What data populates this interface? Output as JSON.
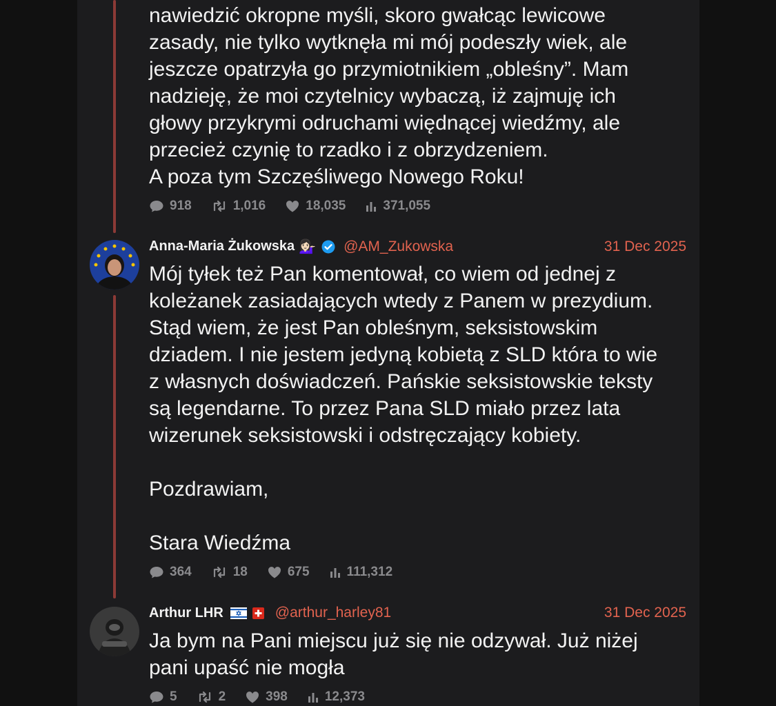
{
  "posts": [
    {
      "text": "nawiedzić okropne myśli, skoro gwałcąc lewicowe\nzasady, nie tylko wytknęła mi mój podeszły wiek, ale\njeszcze opatrzyła go przymiotnikiem „obleśny”. Mam\nnadzieję, że moi czytelnicy wybaczą, iż zajmuję ich\ngłowy przykrymi odruchami więdnącej wiedźmy, ale\nprzecież czynię to rzadko i z obrzydzeniem.\nA poza tym Szczęśliwego Nowego Roku!",
      "stats": {
        "replies": "918",
        "reposts": "1,016",
        "likes": "18,035",
        "views": "371,055"
      }
    },
    {
      "name": "Anna-Maria Żukowska",
      "handle": "@AM_Zukowska",
      "date": "31 Dec 2025",
      "name_emoji": "💁🏻‍♀️",
      "verified_icon": "verified-badge-icon",
      "text": "Mój tyłek też Pan komentował, co wiem od jednej z\nkoleżanek zasiadających wtedy z Panem w prezydium.\nStąd wiem, że jest Pan obleśnym, seksistowskim\ndziadem. I nie jestem jedyną kobietą z SLD która to wie\nz własnych doświadczeń. Pańskie seksistowskie teksty\nsą legendarne. To przez Pana SLD miało przez lata\nwizerunek seksistowski i odstręczający kobiety.\n\nPozdrawiam,\n\nStara Wiedźma",
      "stats": {
        "replies": "364",
        "reposts": "18",
        "likes": "675",
        "views": "111,312"
      }
    },
    {
      "name": "Arthur LHR",
      "handle": "@arthur_harley81",
      "date": "31 Dec 2025",
      "flags": [
        "israel-flag-icon",
        "switzerland-flag-icon"
      ],
      "text": "Ja bym na Pani miejscu już się nie odzywał. Już niżej\npani upaść nie mogła",
      "stats": {
        "replies": "5",
        "reposts": "2",
        "likes": "398",
        "views": "12,373"
      }
    }
  ],
  "colors": {
    "accent": "#e2634f",
    "thread_line": "#8c3a36",
    "background": "#1c1c1e",
    "text": "#f2f2f2",
    "muted": "#8a8a8d",
    "verified": "#1d9bf0"
  }
}
